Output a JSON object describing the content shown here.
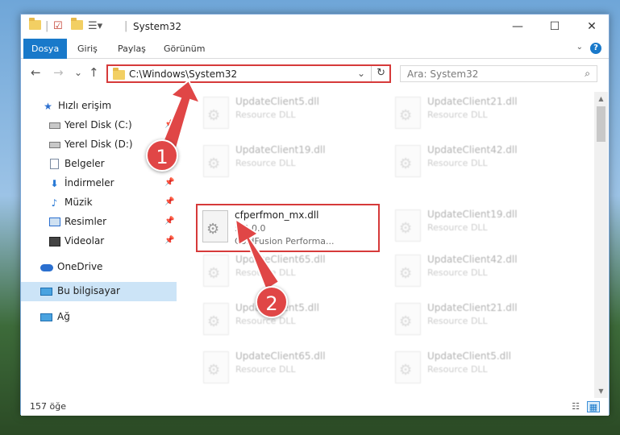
{
  "window": {
    "title": "System32",
    "controls": {
      "minimize": "—",
      "maximize": "☐",
      "close": "✕"
    }
  },
  "ribbon": {
    "tabs": [
      {
        "label": "Dosya",
        "active": true
      },
      {
        "label": "Giriş",
        "active": false
      },
      {
        "label": "Paylaş",
        "active": false
      },
      {
        "label": "Görünüm",
        "active": false
      }
    ],
    "help": "?"
  },
  "navigation": {
    "back": "←",
    "forward": "→",
    "recent": "⌄",
    "up": "↑",
    "address": "C:\\Windows\\System32",
    "address_dropdown": "⌄",
    "refresh": "↻",
    "search_placeholder": "Ara: System32",
    "search_icon": "⌕"
  },
  "sidebar": {
    "items": [
      {
        "label": "Hızlı erişim",
        "icon": "star-icon",
        "pinned": false
      },
      {
        "label": "Yerel Disk (C:)",
        "icon": "drive-icon",
        "pinned": true
      },
      {
        "label": "Yerel Disk (D:)",
        "icon": "drive-icon",
        "pinned": true
      },
      {
        "label": "Belgeler",
        "icon": "documents-icon",
        "pinned": true
      },
      {
        "label": "İndirmeler",
        "icon": "downloads-icon",
        "pinned": true
      },
      {
        "label": "Müzik",
        "icon": "music-icon",
        "pinned": true
      },
      {
        "label": "Resimler",
        "icon": "pictures-icon",
        "pinned": true
      },
      {
        "label": "Videolar",
        "icon": "videos-icon",
        "pinned": true
      },
      {
        "label": "OneDrive",
        "icon": "onedrive-icon",
        "pinned": false
      },
      {
        "label": "Bu bilgisayar",
        "icon": "this-pc-icon",
        "pinned": false,
        "selected": true
      },
      {
        "label": "Ağ",
        "icon": "network-icon",
        "pinned": false
      }
    ],
    "pin_glyph": "📌"
  },
  "files": [
    {
      "name": "UpdateClient5.dll",
      "type": "Resource DLL",
      "faded": true
    },
    {
      "name": "UpdateClient21.dll",
      "type": "Resource DLL",
      "faded": true
    },
    {
      "name": "UpdateClient19.dll",
      "type": "Resource DLL",
      "faded": true
    },
    {
      "name": "UpdateClient42.dll",
      "type": "Resource DLL",
      "faded": true
    },
    {
      "name": "cfperfmon_mx.dll",
      "version": "5.0.0.0",
      "type": "ColdFusion Performa...",
      "faded": false,
      "highlighted": true
    },
    {
      "name": "UpdateClient19.dll",
      "type": "Resource DLL",
      "faded": true
    },
    {
      "name": "UpdateClient65.dll",
      "type": "Resource DLL",
      "faded": true
    },
    {
      "name": "UpdateClient42.dll",
      "type": "Resource DLL",
      "faded": true
    },
    {
      "name": "UpdateClient5.dll",
      "type": "Resource DLL",
      "faded": true
    },
    {
      "name": "UpdateClient21.dll",
      "type": "Resource DLL",
      "faded": true
    },
    {
      "name": "UpdateClient65.dll",
      "type": "Resource DLL",
      "faded": true
    },
    {
      "name": "UpdateClient5.dll",
      "type": "Resource DLL",
      "faded": true
    }
  ],
  "status": {
    "item_count": "157 öğe"
  },
  "annotations": {
    "badge_1": "1",
    "badge_2": "2",
    "highlight_color": "#d63a3a",
    "badge_color": "#e04646"
  },
  "colors": {
    "ribbon_active": "#1979ca",
    "sidebar_selected": "#cce4f7"
  }
}
